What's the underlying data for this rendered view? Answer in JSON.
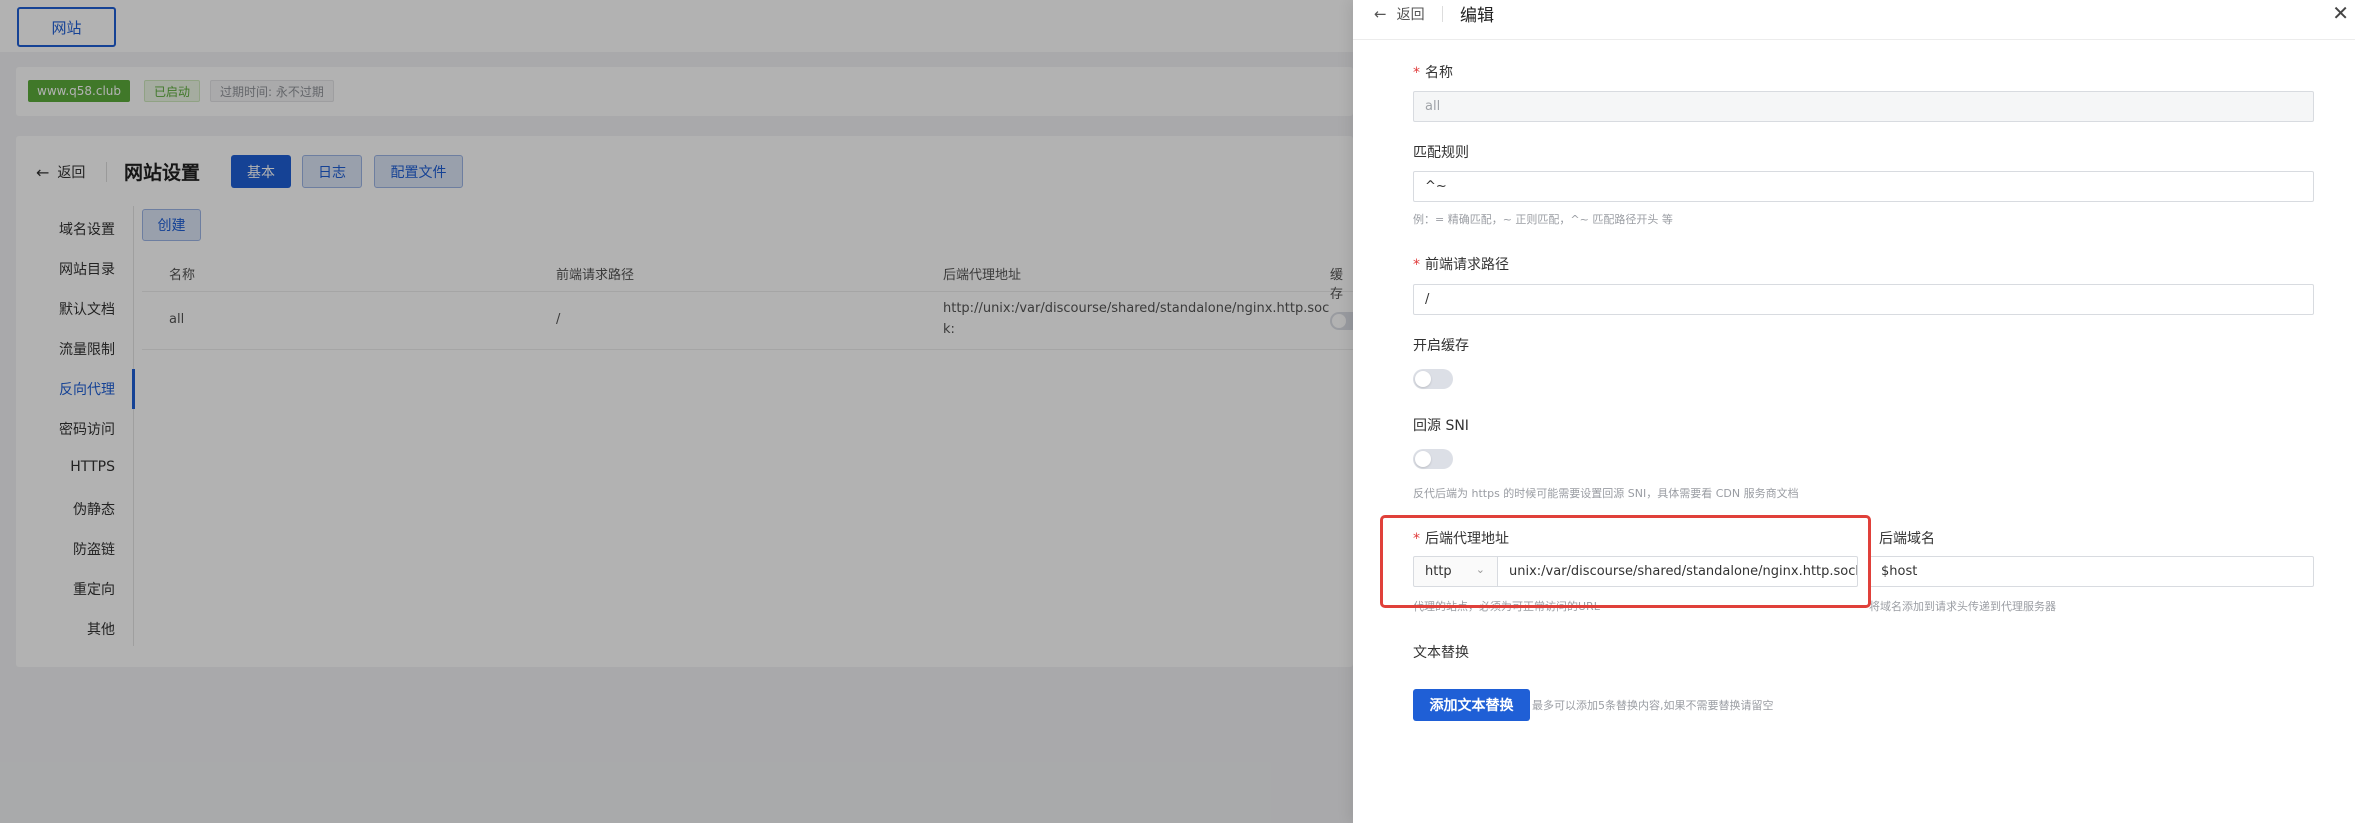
{
  "top_tab": {
    "label": "网站"
  },
  "site_info": {
    "domain": "www.q58.club",
    "status": "已启动",
    "expire": "过期时间: 永不过期"
  },
  "site_settings": {
    "back_label": "返回",
    "title": "网站设置",
    "tabs": {
      "basic": "基本",
      "log": "日志",
      "config": "配置文件"
    },
    "menu": [
      "域名设置",
      "网站目录",
      "默认文档",
      "流量限制",
      "反向代理",
      "密码访问",
      "HTTPS",
      "伪静态",
      "防盗链",
      "重定向",
      "其他"
    ],
    "active_menu": "反向代理",
    "create_label": "创建",
    "table": {
      "headers": [
        "名称",
        "前端请求路径",
        "后端代理地址",
        "缓存"
      ],
      "rows": [
        {
          "name": "all",
          "path": "/",
          "backend_line1": "http://unix:/var/discourse/shared/standalone/nginx.http.soc",
          "backend_line2": "k:"
        }
      ]
    }
  },
  "drawer": {
    "back_label": "返回",
    "title": "编辑",
    "close_icon": "close-icon",
    "fields": {
      "name_label": "名称",
      "name_value": "all",
      "match_label": "匹配规则",
      "match_value": "^~",
      "match_hint": "例：= 精确匹配，~ 正则匹配，^~ 匹配路径开头 等",
      "path_label": "前端请求路径",
      "path_value": "/",
      "cache_label": "开启缓存",
      "sni_label": "回源 SNI",
      "sni_hint": "反代后端为 https 的时候可能需要设置回源 SNI，具体需要看 CDN 服务商文档",
      "proxy_label": "后端代理地址",
      "proxy_protocol": "http",
      "proxy_value": "unix:/var/discourse/shared/standalone/nginx.http.sock:",
      "proxy_hint": "代理的站点，必须为可正常访问的URL",
      "host_label": "后端域名",
      "host_value": "$host",
      "host_hint": "将域名添加到请求头传递到代理服务器",
      "replace_label": "文本替换",
      "add_replace_label": "添加文本替换",
      "replace_hint": "最多可以添加5条替换内容,如果不需要替换请留空"
    }
  },
  "colors": {
    "primary": "#1f5fd6",
    "success": "#5cad3b",
    "required": "#e03a3a",
    "highlight_box": "#e0403a"
  }
}
